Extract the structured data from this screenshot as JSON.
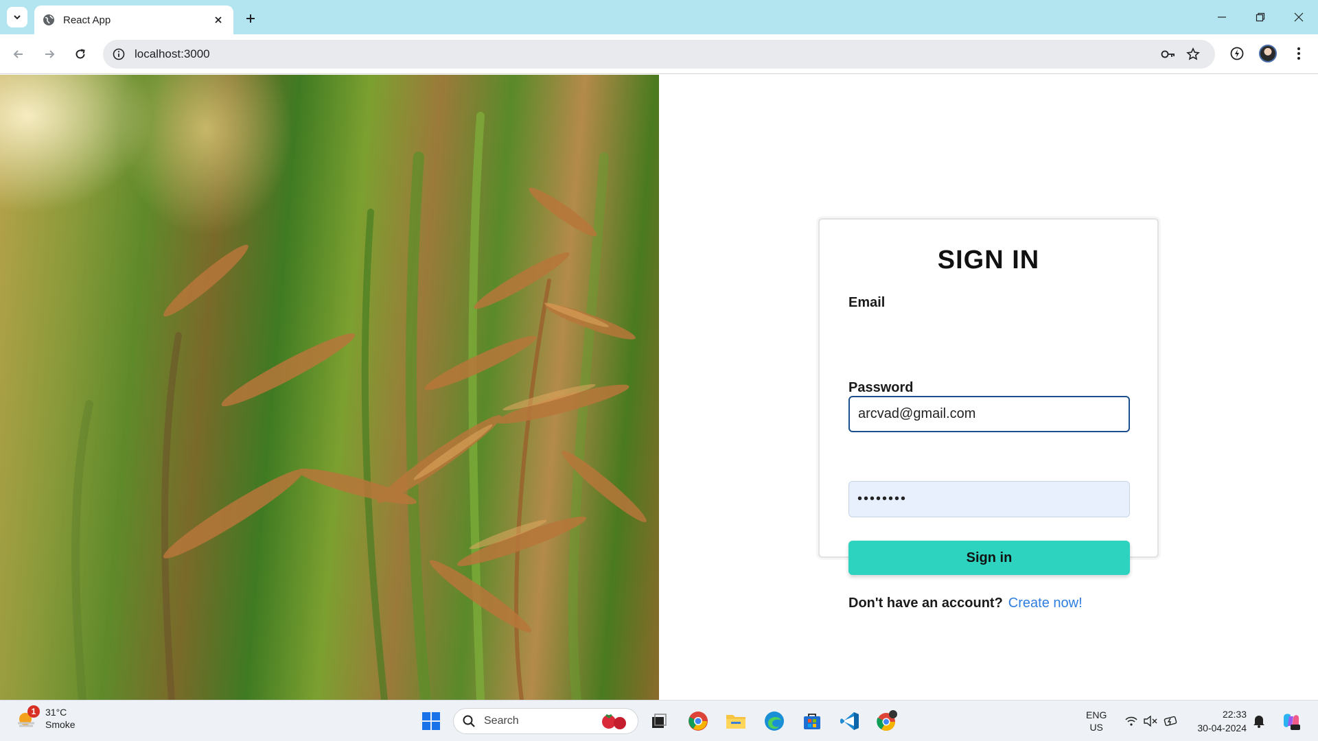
{
  "browser": {
    "tab_title": "React App",
    "url": "localhost:3000"
  },
  "form": {
    "heading": "SIGN IN",
    "email_label": "Email",
    "email_value": "arcvad@gmail.com",
    "password_label": "Password",
    "password_value": "••••••••",
    "submit_label": "Sign in",
    "signup_prompt": "Don't have an account?",
    "signup_link": "Create now!"
  },
  "taskbar": {
    "weather_temp": "31°C",
    "weather_desc": "Smoke",
    "weather_badge": "1",
    "search_placeholder": "Search",
    "lang_top": "ENG",
    "lang_bottom": "US",
    "time": "22:33",
    "date": "30-04-2024"
  },
  "colors": {
    "accent_button": "#2ed3c0",
    "link": "#2f7de0",
    "tabstrip": "#b3e5f0"
  }
}
